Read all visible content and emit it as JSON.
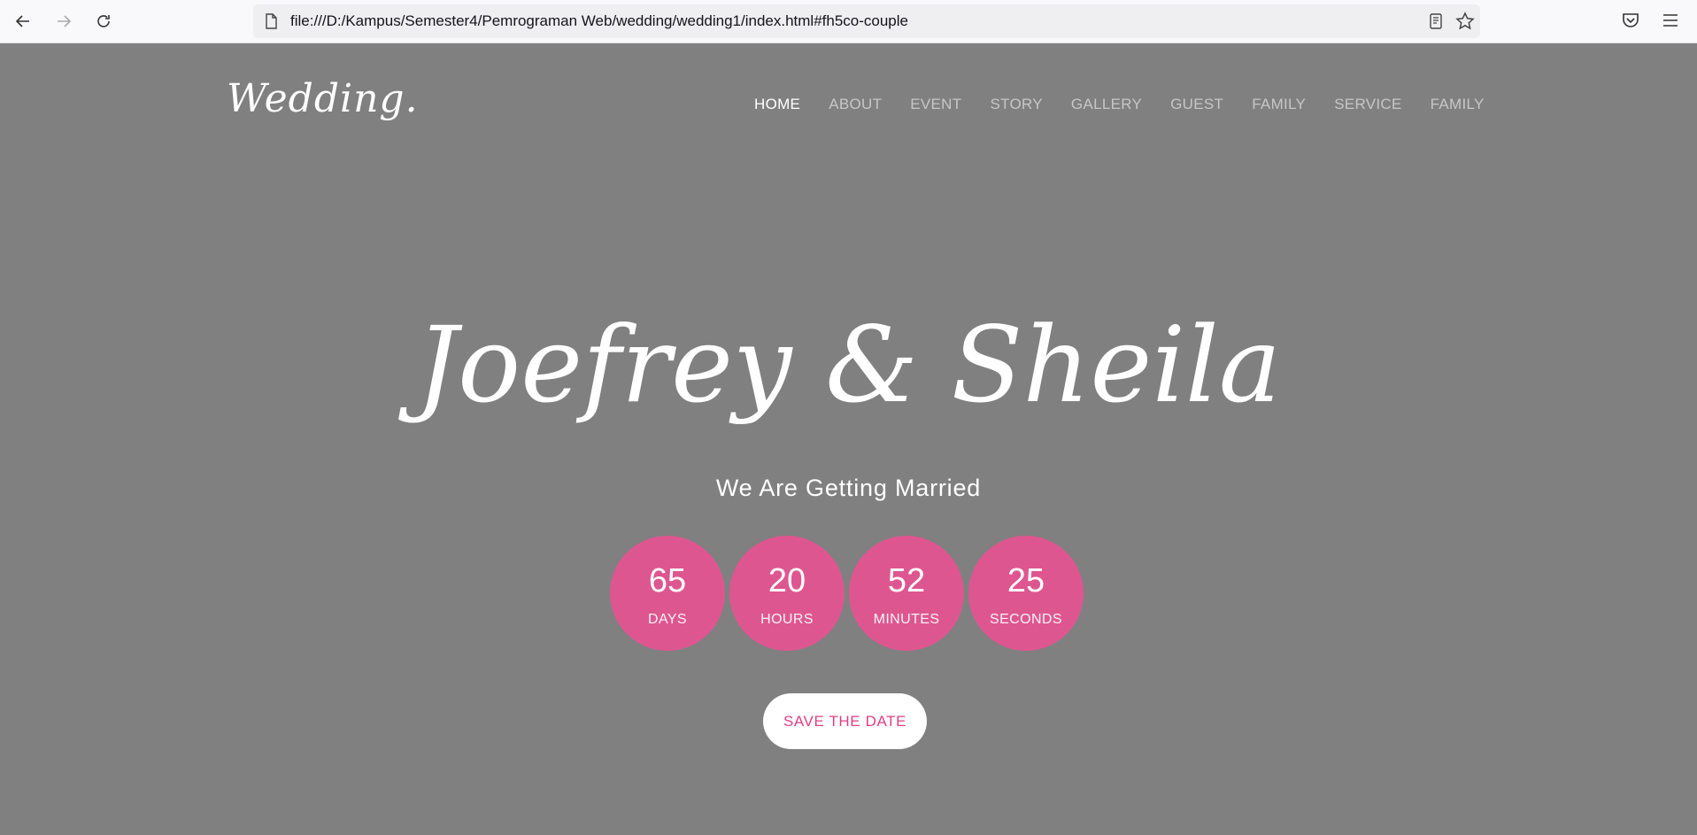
{
  "browser": {
    "url": "file:///D:/Kampus/Semester4/Pemrograman Web/wedding/wedding1/index.html#fh5co-couple"
  },
  "header": {
    "logo": "Wedding.",
    "nav": [
      {
        "label": "HOME",
        "active": true
      },
      {
        "label": "ABOUT"
      },
      {
        "label": "EVENT"
      },
      {
        "label": "STORY"
      },
      {
        "label": "GALLERY"
      },
      {
        "label": "GUEST"
      },
      {
        "label": "FAMILY"
      },
      {
        "label": "SERVICE"
      },
      {
        "label": "FAMILY"
      }
    ]
  },
  "hero": {
    "names": "Joefrey & Sheila",
    "subtitle": "We Are Getting Married",
    "countdown": [
      {
        "value": "65",
        "label": "DAYS"
      },
      {
        "value": "20",
        "label": "HOURS"
      },
      {
        "value": "52",
        "label": "MINUTES"
      },
      {
        "value": "25",
        "label": "SECONDS"
      }
    ],
    "cta": "SAVE THE DATE"
  },
  "colors": {
    "background": "#808080",
    "accent": "#de5690",
    "button_text": "#de3f86"
  }
}
